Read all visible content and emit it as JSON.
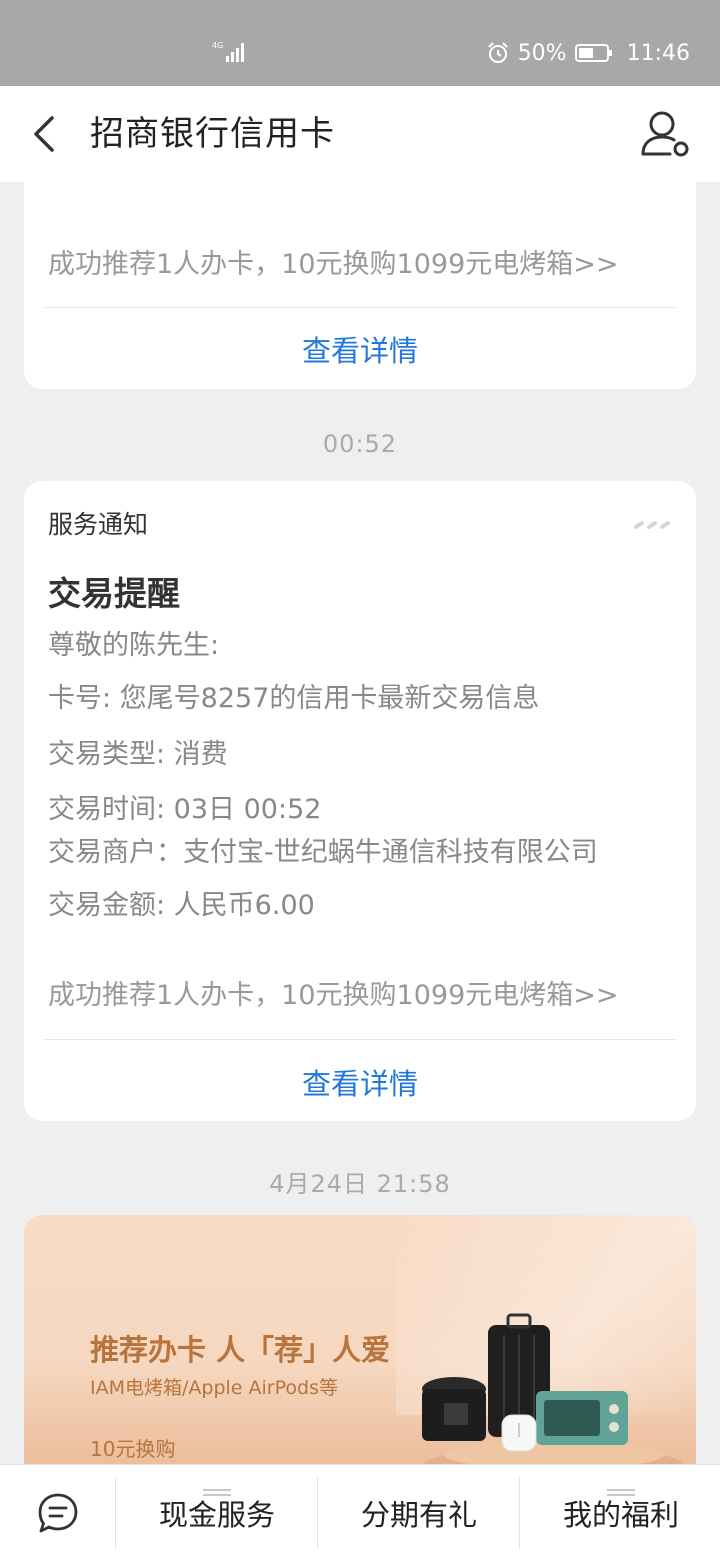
{
  "status_bar": {
    "network": "4G",
    "battery": "50%",
    "time": "11:46"
  },
  "header": {
    "title": "招商银行信用卡"
  },
  "card1": {
    "promo": "成功推荐1人办卡，10元换购1099元电烤箱>>",
    "detail_link": "查看详情"
  },
  "time_sep_1": "00:52",
  "card2": {
    "service_label": "服务通知",
    "title": "交易提醒",
    "greeting": "尊敬的陈先生:",
    "card_no": "卡号: 您尾号8257的信用卡最新交易信息",
    "type": "交易类型: 消费",
    "time": "交易时间: 03日 00:52",
    "merchant": "交易商户：支付宝-世纪蜗牛通信科技有限公司",
    "amount": "交易金额: 人民币6.00",
    "promo": "成功推荐1人办卡，10元换购1099元电烤箱>>",
    "detail_link": "查看详情"
  },
  "time_sep_2": "4月24日 21:58",
  "banner": {
    "title": "推荐办卡 人「荐」人爱",
    "subtitle": "IAM电烤箱/Apple AirPods等",
    "price": "10元换购"
  },
  "bottom_bar": {
    "items": [
      "现金服务",
      "分期有礼",
      "我的福利"
    ]
  },
  "colors": {
    "link": "#2277dd",
    "banner_text": "#b8743d"
  }
}
